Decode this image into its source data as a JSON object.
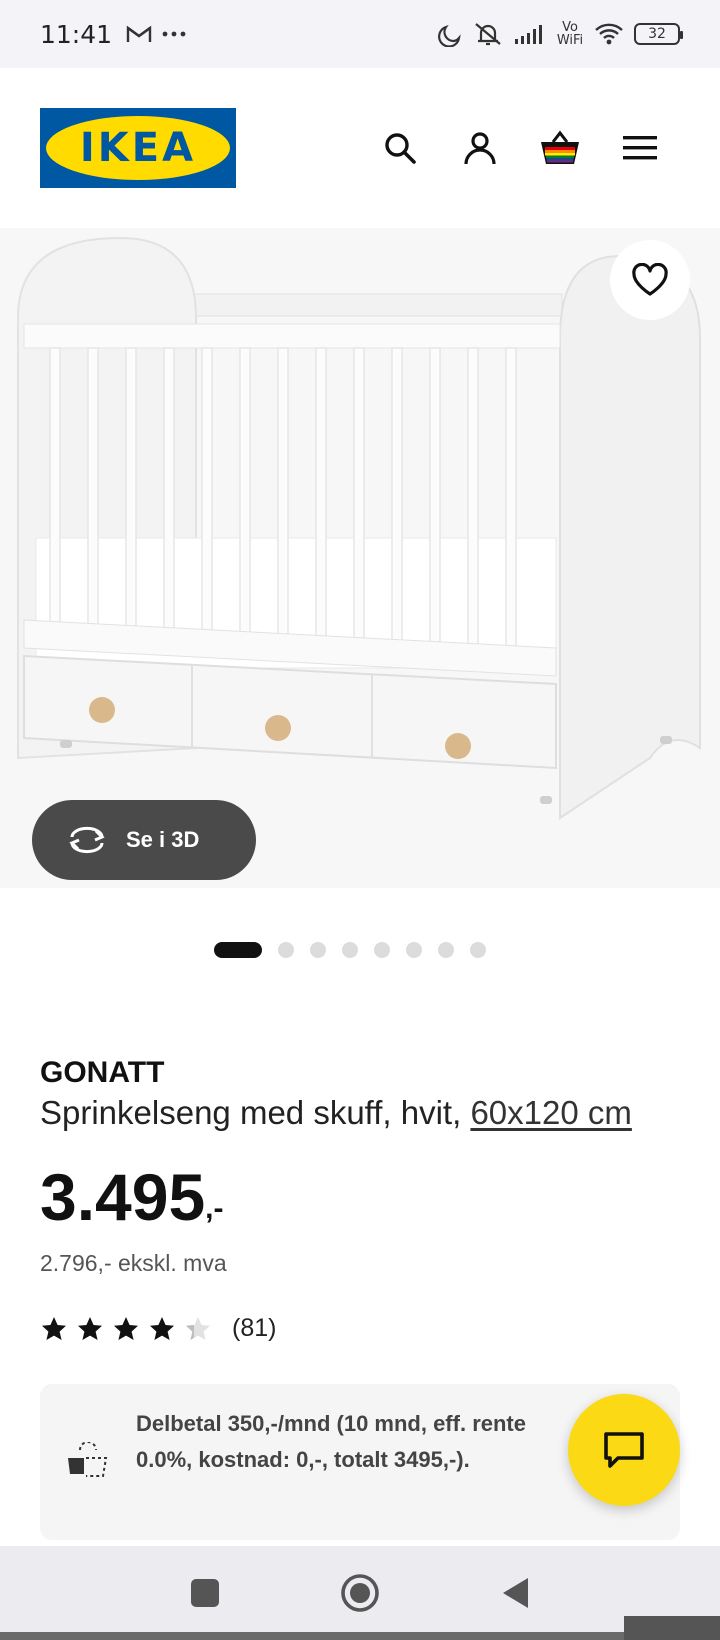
{
  "status_bar": {
    "time": "11:41",
    "left_icons": [
      "gmail-icon",
      "more-dots-icon"
    ],
    "right_icons": [
      "moon-icon",
      "vibrate-icon",
      "signal-icon",
      "vowifi-icon",
      "wifi-icon"
    ],
    "vowifi_label": "Vo WiFi",
    "battery": "32"
  },
  "header": {
    "logo_text": "IKEA",
    "icons": [
      "search-icon",
      "user-icon",
      "basket-icon",
      "menu-icon"
    ]
  },
  "gallery": {
    "see_3d_label": "Se i 3D",
    "total_images": 8,
    "active_index": 0
  },
  "product": {
    "name": "GONATT",
    "description": "Sprinkelseng med skuff, hvit,",
    "size_link": "60x120 cm",
    "price_main": "3.495",
    "price_suffix": ",-",
    "price_ex_vat": "2.796,- ekskl. mva",
    "rating_value": 4,
    "rating_max": 5,
    "rating_count": "(81)"
  },
  "installment": {
    "text": "Delbetal 350,-/mnd (10 mnd, eff. rente 0.0%, kostnad: 0,-, totalt 3495,-)."
  },
  "colors": {
    "ikea_blue": "#0058a3",
    "ikea_yellow": "#ffdb00",
    "chat_yellow": "#fbd914"
  }
}
